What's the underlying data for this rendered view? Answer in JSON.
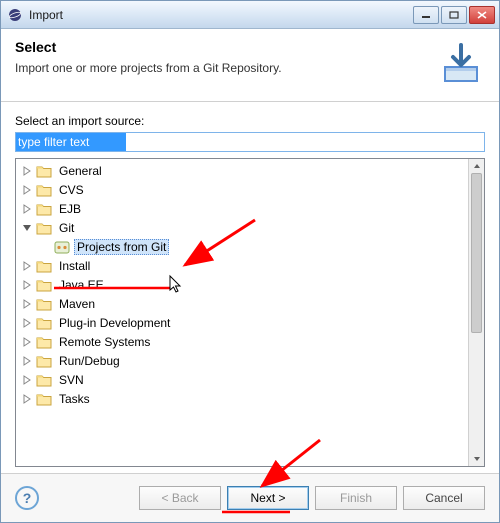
{
  "window": {
    "title": "Import"
  },
  "header": {
    "heading": "Select",
    "description": "Import one or more projects from a Git Repository."
  },
  "source": {
    "label": "Select an import source:",
    "filter_text": "type filter text"
  },
  "tree": {
    "items": [
      {
        "label": "General",
        "expanded": false
      },
      {
        "label": "CVS",
        "expanded": false
      },
      {
        "label": "EJB",
        "expanded": false
      },
      {
        "label": "Git",
        "expanded": true,
        "children": [
          {
            "label": "Projects from Git",
            "selected": true
          }
        ]
      },
      {
        "label": "Install",
        "expanded": false
      },
      {
        "label": "Java EE",
        "expanded": false
      },
      {
        "label": "Maven",
        "expanded": false
      },
      {
        "label": "Plug-in Development",
        "expanded": false
      },
      {
        "label": "Remote Systems",
        "expanded": false
      },
      {
        "label": "Run/Debug",
        "expanded": false
      },
      {
        "label": "SVN",
        "expanded": false
      },
      {
        "label": "Tasks",
        "expanded": false
      }
    ]
  },
  "buttons": {
    "help": "?",
    "back": "< Back",
    "next": "Next >",
    "finish": "Finish",
    "cancel": "Cancel"
  }
}
